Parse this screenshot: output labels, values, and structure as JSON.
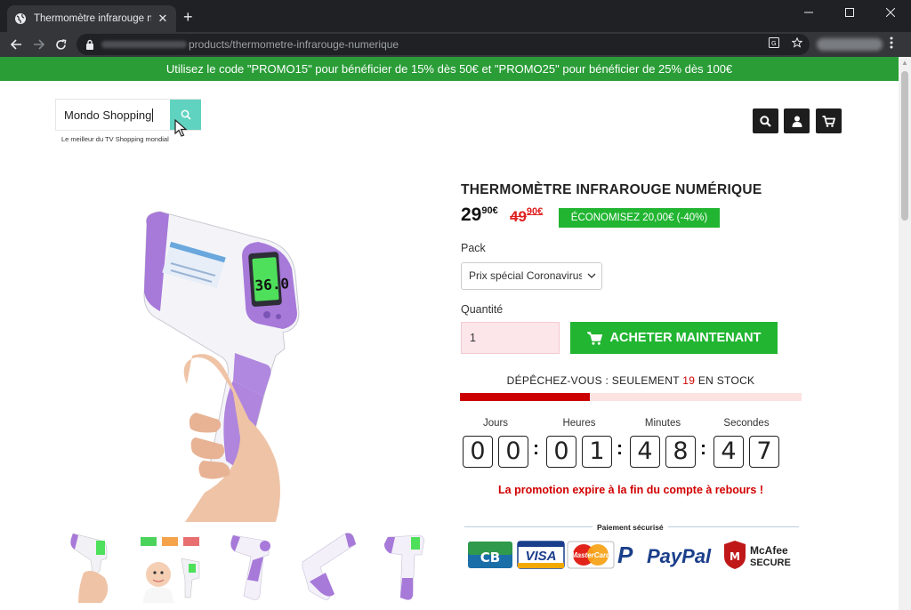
{
  "browser": {
    "tab_title": "Thermomètre infrarouge numériq",
    "url_path": "products/thermometre-infrarouge-numerique",
    "new_tab": "+",
    "tab_close": "✕"
  },
  "promo_banner": "Utilisez le code \"PROMO15\" pour bénéficier de 15% dès 50€ et \"PROMO25\"  pour bénéficier de 25% dès 100€",
  "store": {
    "name": "Mondo Shopping",
    "tagline": "Le meilleur du TV Shopping mondial"
  },
  "product": {
    "title": "THERMOMÈTRE INFRAROUGE NUMÉRIQUE",
    "price_main": "29",
    "price_cents": "90€",
    "old_main": "49",
    "old_cents": "90€",
    "savings": "ÉCONOMISEZ 20,00€ (-40%)",
    "pack_label": "Pack",
    "pack_value": "Prix spécial Coronavirus",
    "qty_label": "Quantité",
    "qty_value": "1",
    "buy_label": "ACHETER MAINTENANT",
    "display_reading": "36.0"
  },
  "stock": {
    "prefix": "DÉPÊCHEZ-VOUS : SEULEMENT ",
    "count": "19",
    "suffix": " EN STOCK",
    "level_fraction": 0.38
  },
  "countdown": {
    "labels": [
      "Jours",
      "Heures",
      "Minutes",
      "Secondes"
    ],
    "digits": [
      "0",
      "0",
      "0",
      "1",
      "4",
      "8",
      "4",
      "7"
    ],
    "expire_text": "La promotion expire à la fin du compte à rebours !"
  },
  "payment": {
    "label": "Paiement sécurisé",
    "cb": "CB",
    "visa": "VISA",
    "mastercard": "MasterCard",
    "paypal": "PayPal",
    "mcafee_top": "McAfee",
    "mcafee_bottom": "SECURE"
  },
  "colors": {
    "promo_green": "#2a9d37",
    "accent_green": "#21b531",
    "alert_red": "#d10000",
    "product_purple": "#a779d9"
  }
}
